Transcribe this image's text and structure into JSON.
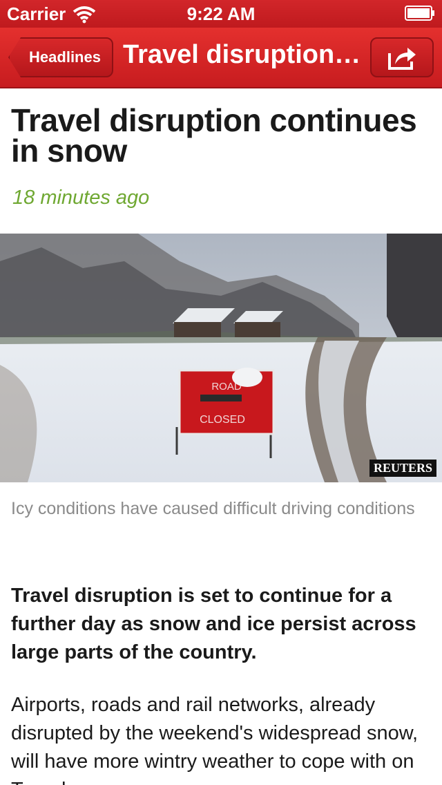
{
  "status_bar": {
    "carrier": "Carrier",
    "time": "9:22 AM",
    "icons": [
      "wifi-icon",
      "battery-icon"
    ]
  },
  "nav_bar": {
    "back_label": "Headlines",
    "title": "Travel disruption continues in snow",
    "share_icon": "share-icon",
    "color": "#d2262a"
  },
  "article": {
    "headline": "Travel disruption continues in snow",
    "timestamp": "18 minutes ago",
    "timestamp_color": "#6fa832",
    "image": {
      "sign_text_line1": "ROAD",
      "sign_text_line2": "CLOSED",
      "credit": "REUTERS"
    },
    "caption": "Icy conditions have caused difficult driving conditions",
    "lead": "Travel disruption is set to continue for a further day as snow and ice persist across large parts of the country.",
    "body": "Airports, roads and rail networks, already disrupted by the weekend's widespread snow, will have more wintry weather to cope with on Tuesday."
  }
}
